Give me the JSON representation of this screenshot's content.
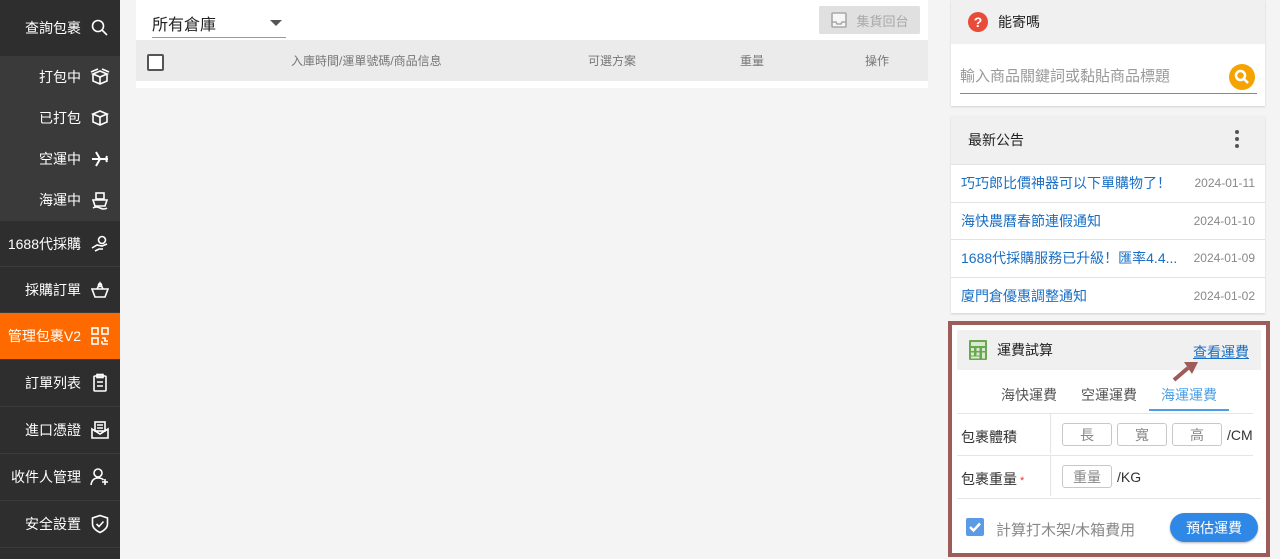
{
  "sidebar": {
    "items": [
      {
        "label": "查詢包裹",
        "icon": "search-icon"
      },
      {
        "label": "打包中",
        "icon": "box-open-icon"
      },
      {
        "label": "已打包",
        "icon": "box-icon"
      },
      {
        "label": "空運中",
        "icon": "airplane-icon"
      },
      {
        "label": "海運中",
        "icon": "ship-icon"
      },
      {
        "label": "1688代採購",
        "icon": "hand-money-icon"
      },
      {
        "label": "採購訂單",
        "icon": "basket-icon"
      },
      {
        "label": "管理包裹V2",
        "icon": "qr-grid-icon",
        "active": true
      },
      {
        "label": "訂單列表",
        "icon": "clipboard-icon"
      },
      {
        "label": "進口憑證",
        "icon": "envelope-doc-icon"
      },
      {
        "label": "收件人管理",
        "icon": "add-user-icon"
      },
      {
        "label": "安全設置",
        "icon": "shield-check-icon"
      }
    ]
  },
  "main": {
    "warehouse_select": "所有倉庫",
    "consolidate_button": "集貨回台",
    "table_headers": [
      "入庫時間/運單號碼/商品信息",
      "可選方案",
      "重量",
      "操作"
    ]
  },
  "can_ship": {
    "title": "能寄嗎",
    "search_placeholder": "輸入商品關鍵詞或黏貼商品標題"
  },
  "notices": {
    "title": "最新公告",
    "items": [
      {
        "title": "巧巧郎比價神器可以下單購物了！",
        "date": "2024-01-11"
      },
      {
        "title": "海快農曆春節連假通知",
        "date": "2024-01-10"
      },
      {
        "title": "1688代採購服務已升級！匯率4.4...",
        "date": "2024-01-09"
      },
      {
        "title": "廈門倉優惠調整通知",
        "date": "2024-01-02"
      }
    ]
  },
  "freight": {
    "title": "運費試算",
    "view_link": "查看運費",
    "tabs": [
      "海快運費",
      "空運運費",
      "海運運費"
    ],
    "active_tab": "海運運費",
    "volume_label": "包裹體積",
    "length": "長",
    "width": "寬",
    "height": "高",
    "volume_unit": "/CM",
    "weight_label": "包裹重量",
    "required_mark": "*",
    "weight": "重量",
    "weight_unit": "/KG",
    "crate_checkbox_label": "計算打木架/木箱費用",
    "crate_checked": true,
    "estimate_button": "預估運費"
  },
  "colors": {
    "accent": "#ff6a00",
    "sidebar": "#2e2e2e",
    "link": "#1a6fc4",
    "primary_button": "#2f88e6",
    "highlight_frame": "#9e5c58"
  }
}
